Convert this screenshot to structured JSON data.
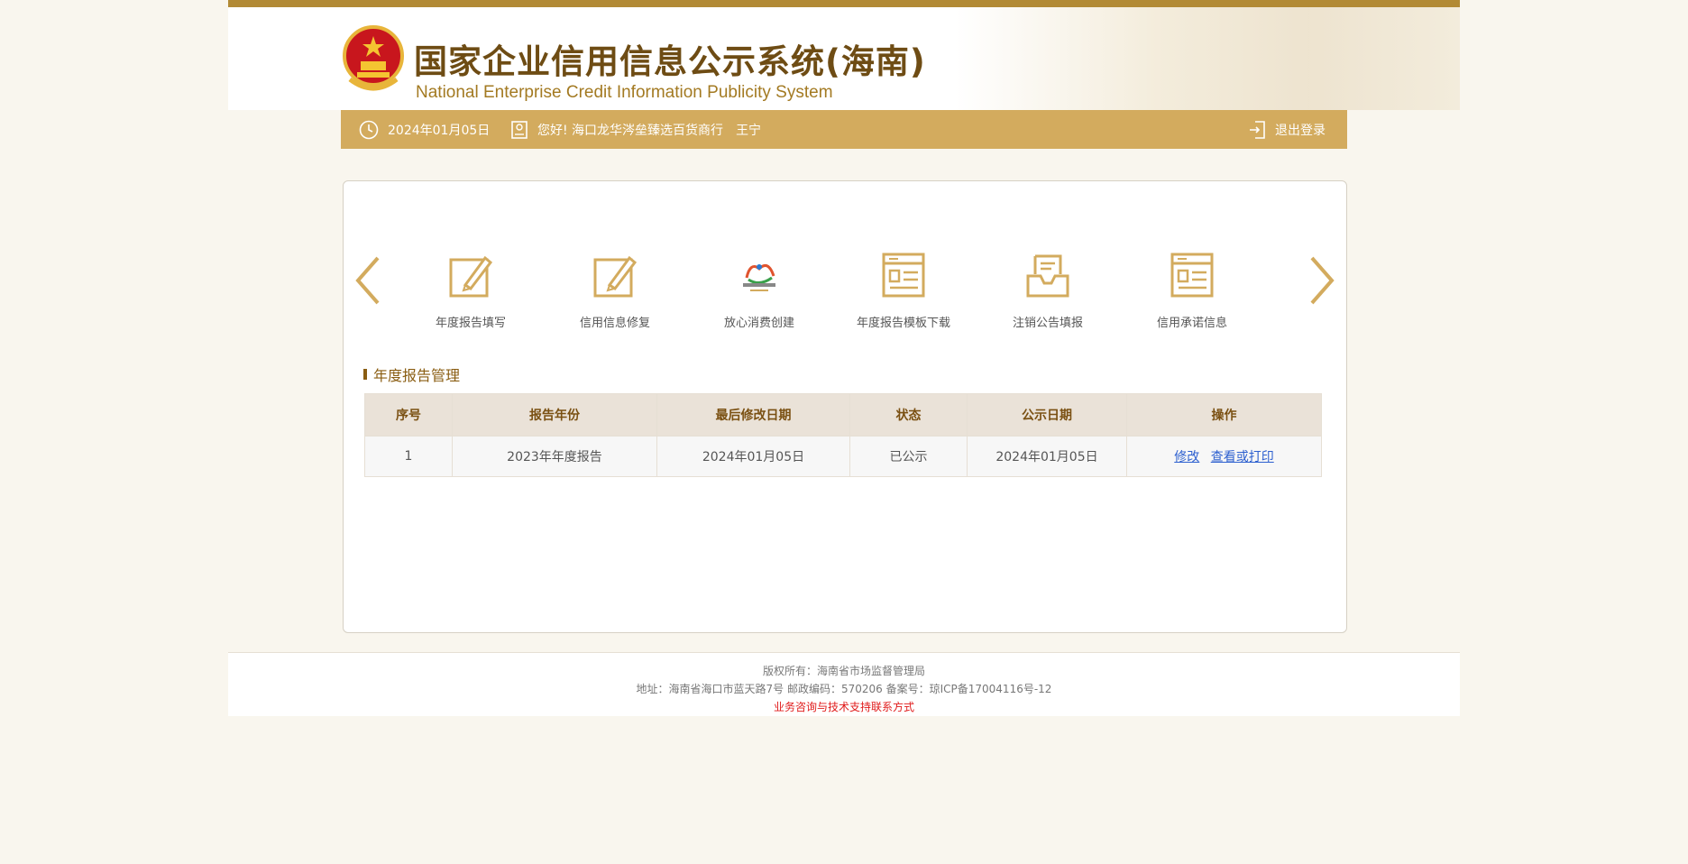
{
  "header": {
    "title_cn": "国家企业信用信息公示系统(海南)",
    "title_en": "National Enterprise Credit Information Publicity System"
  },
  "infobar": {
    "date": "2024年01月05日",
    "greeting": "您好! 海口龙华涔垒臻选百货商行",
    "user": "王宁",
    "logout": "退出登录"
  },
  "menu": [
    {
      "label": "年度报告填写",
      "icon": "edit-icon"
    },
    {
      "label": "信用信息修复",
      "icon": "edit-icon"
    },
    {
      "label": "放心消费创建",
      "icon": "consumer-logo"
    },
    {
      "label": "年度报告模板下载",
      "icon": "document-icon"
    },
    {
      "label": "注销公告填报",
      "icon": "inbox-icon"
    },
    {
      "label": "信用承诺信息",
      "icon": "document-icon"
    }
  ],
  "section": {
    "title": "年度报告管理"
  },
  "table": {
    "headers": [
      "序号",
      "报告年份",
      "最后修改日期",
      "状态",
      "公示日期",
      "操作"
    ],
    "rows": [
      {
        "index": "1",
        "year": "2023年年度报告",
        "modified": "2024年01月05日",
        "status": "已公示",
        "published": "2024年01月05日",
        "action_edit": "修改",
        "action_view": "查看或打印"
      }
    ]
  },
  "footer": {
    "copyright": "版权所有：海南省市场监督管理局",
    "address": "地址：海南省海口市蓝天路7号 邮政编码：570206 备案号：琼ICP备17004116号-12",
    "contact": "业务咨询与技术支持联系方式"
  },
  "colors": {
    "gold": "#d3ab5e",
    "brown": "#6e4c14",
    "link": "#2c5fcf",
    "red": "#e01a1a"
  }
}
